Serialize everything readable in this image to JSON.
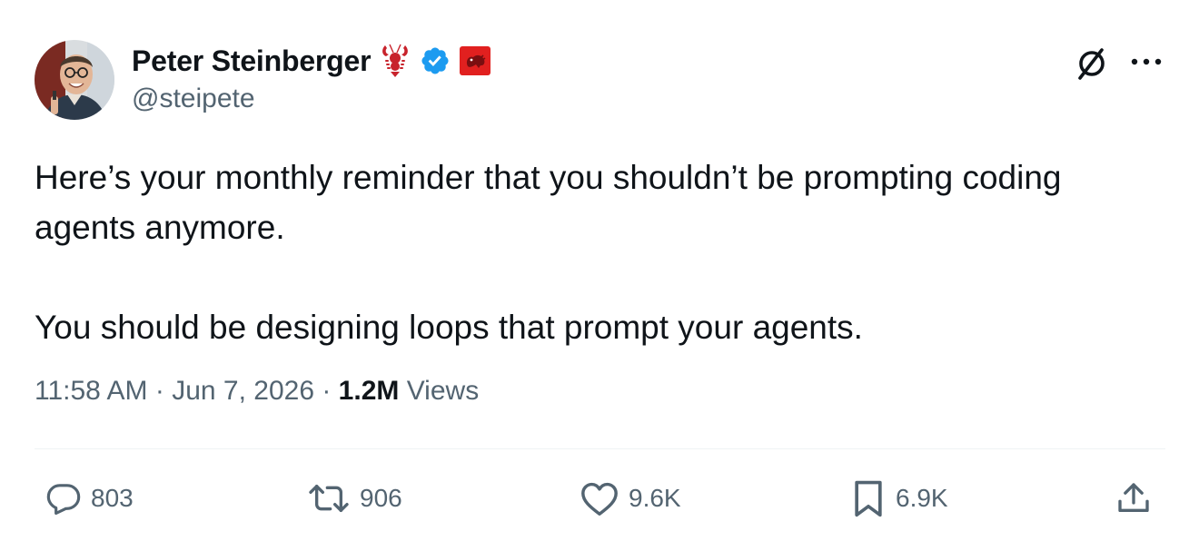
{
  "author": {
    "display_name": "Peter Steinberger",
    "handle": "@steipete",
    "badges": [
      "lobster-emoji",
      "verified-badge-icon",
      "lobster-flag-icon"
    ],
    "verified_color": "#1d9bf0"
  },
  "header": {
    "grok_icon": "grok-icon",
    "more_icon": "more-icon"
  },
  "tweet": {
    "paragraphs": [
      "Here’s your monthly reminder that you shouldn’t be prompting coding agents anymore.",
      "You should be designing loops that prompt your agents."
    ],
    "time": "11:58 AM",
    "separator": "·",
    "date": "Jun 7, 2026",
    "views_count": "1.2M",
    "views_label": "Views"
  },
  "actions": {
    "replies": "803",
    "reposts": "906",
    "likes": "9.6K",
    "bookmarks": "6.9K"
  },
  "colors": {
    "text_primary": "#0f1419",
    "text_secondary": "#536471",
    "divider": "#eff3f4"
  }
}
